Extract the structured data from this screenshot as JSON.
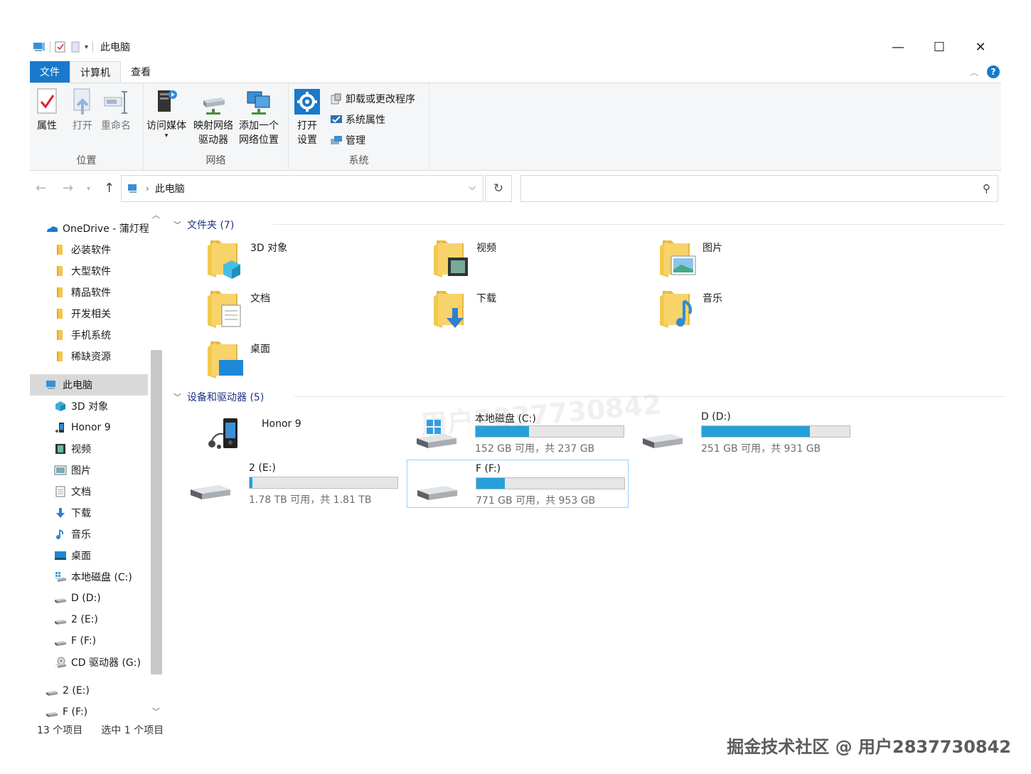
{
  "window": {
    "title": "此电脑",
    "controls": {
      "minimize": "—",
      "maximize": "☐",
      "close": "✕"
    }
  },
  "ribbon_tabs": [
    {
      "label": "文件"
    },
    {
      "label": "计算机"
    },
    {
      "label": "查看"
    }
  ],
  "help_label": "?",
  "ribbon": {
    "location_group": {
      "label": "位置",
      "buttons": [
        {
          "label": "属性",
          "icon": "properties-icon"
        },
        {
          "label": "打开",
          "icon": "open-icon"
        },
        {
          "label": "重命名",
          "icon": "rename-icon"
        }
      ]
    },
    "network_group": {
      "label": "网络",
      "buttons": [
        {
          "label": "访问媒体",
          "icon": "media-server-icon"
        },
        {
          "label_line1": "映射网络",
          "label_line2": "驱动器",
          "icon": "map-drive-icon"
        },
        {
          "label_line1": "添加一个",
          "label_line2": "网络位置",
          "icon": "network-location-icon"
        }
      ]
    },
    "system_group": {
      "label": "系统",
      "open_settings_line1": "打开",
      "open_settings_line2": "设置",
      "small_buttons": [
        {
          "label": "卸载或更改程序",
          "icon": "uninstall-icon"
        },
        {
          "label": "系统属性",
          "icon": "system-properties-icon"
        },
        {
          "label": "管理",
          "icon": "manage-icon"
        }
      ]
    }
  },
  "address": {
    "path": "此电脑",
    "search_placeholder": ""
  },
  "nav_pane": {
    "items": [
      {
        "label": "OneDrive - 蒲灯程",
        "icon": "onedrive-icon",
        "level": 0
      },
      {
        "label": "必装软件",
        "icon": "folder-icon",
        "level": 1
      },
      {
        "label": "大型软件",
        "icon": "folder-icon",
        "level": 1
      },
      {
        "label": "精品软件",
        "icon": "folder-icon",
        "level": 1
      },
      {
        "label": "开发相关",
        "icon": "folder-icon",
        "level": 1
      },
      {
        "label": "手机系统",
        "icon": "folder-icon",
        "level": 1
      },
      {
        "label": "稀缺资源",
        "icon": "folder-icon",
        "level": 1
      },
      {
        "label": "此电脑",
        "icon": "this-pc-icon",
        "level": 0,
        "selected": true
      },
      {
        "label": "3D 对象",
        "icon": "3d-objects-icon",
        "level": 1
      },
      {
        "label": "Honor 9",
        "icon": "phone-icon",
        "level": 1
      },
      {
        "label": "视频",
        "icon": "video-icon",
        "level": 1
      },
      {
        "label": "图片",
        "icon": "pictures-icon",
        "level": 1
      },
      {
        "label": "文档",
        "icon": "documents-icon",
        "level": 1
      },
      {
        "label": "下载",
        "icon": "downloads-icon",
        "level": 1
      },
      {
        "label": "音乐",
        "icon": "music-icon",
        "level": 1
      },
      {
        "label": "桌面",
        "icon": "desktop-icon",
        "level": 1
      },
      {
        "label": "本地磁盘 (C:)",
        "icon": "windows-drive-icon",
        "level": 1
      },
      {
        "label": "D (D:)",
        "icon": "drive-icon",
        "level": 1
      },
      {
        "label": "2 (E:)",
        "icon": "drive-icon",
        "level": 1
      },
      {
        "label": "F (F:)",
        "icon": "drive-icon",
        "level": 1
      },
      {
        "label": "CD 驱动器 (G:)",
        "icon": "cd-drive-icon",
        "level": 1
      },
      {
        "label": "2 (E:)",
        "icon": "drive-icon",
        "level": 0
      },
      {
        "label": "F (F:)",
        "icon": "drive-icon",
        "level": 0
      }
    ]
  },
  "content": {
    "folders_header": "文件夹 (7)",
    "folders": [
      {
        "label": "3D 对象",
        "icon": "3d-objects-folder-icon"
      },
      {
        "label": "视频",
        "icon": "videos-folder-icon"
      },
      {
        "label": "图片",
        "icon": "pictures-folder-icon"
      },
      {
        "label": "文档",
        "icon": "documents-folder-icon"
      },
      {
        "label": "下载",
        "icon": "downloads-folder-icon"
      },
      {
        "label": "音乐",
        "icon": "music-folder-icon"
      },
      {
        "label": "桌面",
        "icon": "desktop-folder-icon"
      }
    ],
    "devices_header": "设备和驱动器 (5)",
    "devices": [
      {
        "label": "Honor 9",
        "icon": "phone-device-icon"
      },
      {
        "label": "本地磁盘 (C:)",
        "icon": "windows-drive-icon",
        "used_fraction": 0.36,
        "size_text": "152 GB 可用，共 237 GB"
      },
      {
        "label": "D (D:)",
        "icon": "drive-icon",
        "used_fraction": 0.73,
        "size_text": "251 GB 可用，共 931 GB"
      },
      {
        "label": "2 (E:)",
        "icon": "drive-icon",
        "used_fraction": 0.02,
        "size_text": "1.78 TB 可用，共 1.81 TB"
      },
      {
        "label": "F (F:)",
        "icon": "drive-icon",
        "used_fraction": 0.19,
        "size_text": "771 GB 可用，共 953 GB",
        "selected": true
      }
    ]
  },
  "status_bar": {
    "item_count": "13 个项目",
    "selected_count": "选中 1 个项目"
  },
  "watermark": {
    "center": "用户2837730842",
    "footer": "掘金技术社区 @ 用户2837730842"
  },
  "colors": {
    "accent": "#1979ca",
    "bar_fill": "#26a0da",
    "selection": "#d9d9d9",
    "section_header": "#1e3287"
  }
}
